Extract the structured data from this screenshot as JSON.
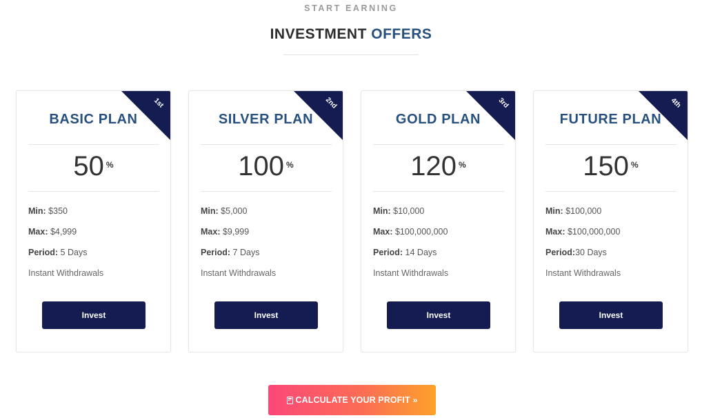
{
  "section": {
    "eyebrow": "START EARNING",
    "heading_part1": "INVESTMENT ",
    "heading_part2": "OFFERS"
  },
  "plans": [
    {
      "rank": "1st",
      "name": "BASIC PLAN",
      "rate": "50",
      "rate_unit": "%",
      "min_label": "Min:",
      "min": " $350",
      "max_label": "Max:",
      "max": " $4,999",
      "period_label": "Period:",
      "period": " 5 Days",
      "feature": "Instant Withdrawals",
      "button": "Invest"
    },
    {
      "rank": "2nd",
      "name": "SILVER PLAN",
      "rate": "100",
      "rate_unit": "%",
      "min_label": "Min:",
      "min": " $5,000",
      "max_label": "Max:",
      "max": " $9,999",
      "period_label": "Period:",
      "period": " 7 Days",
      "feature": "Instant Withdrawals",
      "button": "Invest"
    },
    {
      "rank": "3rd",
      "name": "GOLD PLAN",
      "rate": "120",
      "rate_unit": "%",
      "min_label": "Min:",
      "min": " $10,000",
      "max_label": "Max:",
      "max": " $100,000,000",
      "period_label": "Period:",
      "period": " 14 Days",
      "feature": "Instant Withdrawals",
      "button": "Invest"
    },
    {
      "rank": "4th",
      "name": "FUTURE PLAN",
      "rate": "150",
      "rate_unit": "%",
      "min_label": "Min:",
      "min": " $100,000",
      "max_label": "Max:",
      "max": " $100,000,000",
      "period_label": "Period:",
      "period": "30 Days",
      "feature": "Instant Withdrawals",
      "button": "Invest"
    }
  ],
  "cta": {
    "label": "CALCULATE YOUR PROFIT",
    "icon": "calculator-icon",
    "trailing_icon": "double-chevron-right-icon",
    "trailing_glyph": "»"
  },
  "colors": {
    "navy": "#141c52",
    "accent_blue": "#27507f",
    "gradient_start": "#fb4779",
    "gradient_end": "#fca12a"
  }
}
